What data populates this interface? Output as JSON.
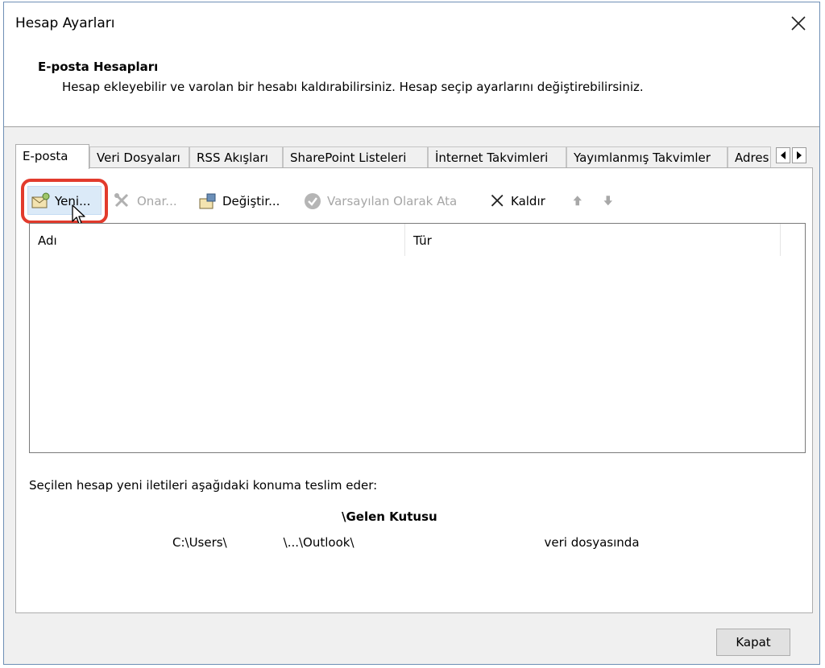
{
  "window": {
    "title": "Hesap Ayarları"
  },
  "header": {
    "title": "E-posta Hesapları",
    "description": "Hesap ekleyebilir ve varolan bir hesabı kaldırabilirsiniz. Hesap seçip ayarlarını değiştirebilirsiniz."
  },
  "tabs": [
    {
      "label": "E-posta",
      "active": true
    },
    {
      "label": "Veri Dosyaları"
    },
    {
      "label": "RSS Akışları"
    },
    {
      "label": "SharePoint Listeleri"
    },
    {
      "label": "İnternet Takvimleri"
    },
    {
      "label": "Yayımlanmış Takvimler"
    },
    {
      "label": "Adres Defterleri"
    }
  ],
  "toolbar": {
    "new_label": "Yeni...",
    "repair_label": "Onar...",
    "change_label": "Değiştir...",
    "set_default_label": "Varsayılan Olarak Ata",
    "remove_label": "Kaldır"
  },
  "list": {
    "columns": [
      "Adı",
      "Tür"
    ]
  },
  "delivery": {
    "info": "Seçilen hesap yeni iletileri aşağıdaki konuma teslim eder:",
    "inbox": "\\Gelen Kutusu",
    "path_users": "C:\\Users\\",
    "path_outlook": "\\...\\Outlook\\",
    "path_suffix": "veri dosyasında"
  },
  "footer": {
    "close_label": "Kapat"
  },
  "colors": {
    "highlight": "#e23b2d",
    "selected_bg": "#dbeaf8"
  }
}
